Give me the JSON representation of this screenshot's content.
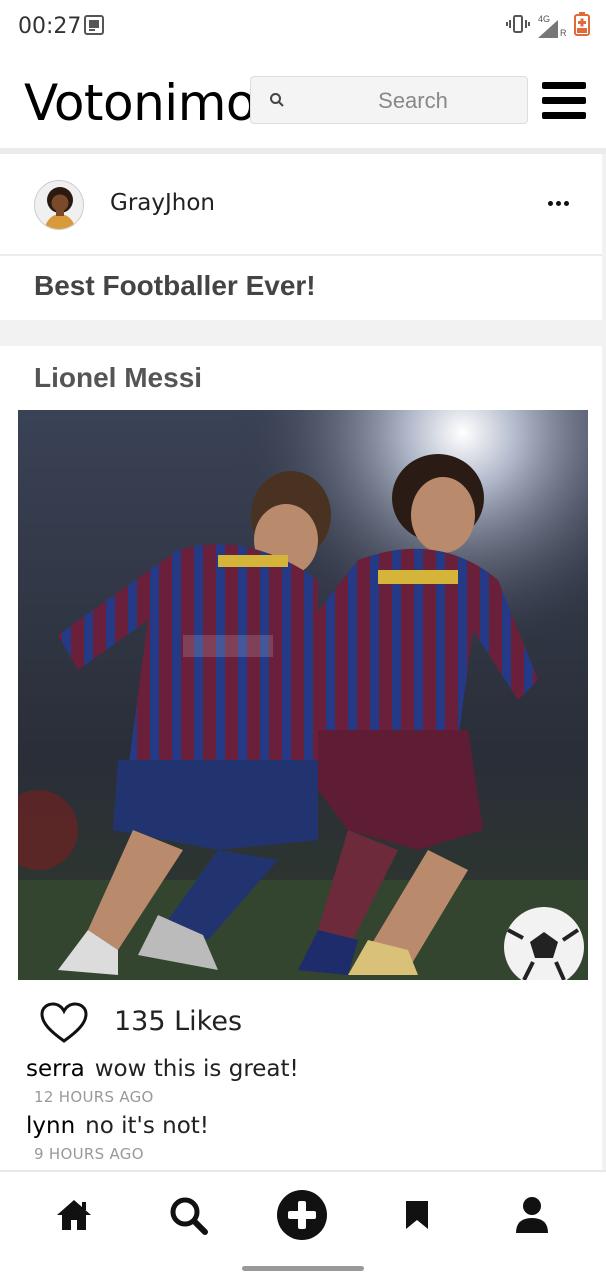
{
  "status_bar": {
    "time": "00:27",
    "network": "4G",
    "roaming": "R",
    "icons": [
      "screenshot-icon",
      "vibrate-icon",
      "signal-icon",
      "battery-icon"
    ]
  },
  "header": {
    "app_title": "Votonimo",
    "search_placeholder": "Search",
    "menu_icon": "hamburger-menu-icon"
  },
  "post": {
    "username": "GrayJhon",
    "caption": "Best Footballer Ever!",
    "more_icon": "more-dots-icon"
  },
  "entry": {
    "title": "Lionel Messi",
    "likes_label": "135 Likes",
    "likes_count": 135,
    "comments": [
      {
        "user": "serra",
        "text": "wow this is great!",
        "time": "12 HOURS AGO"
      },
      {
        "user": "lynn",
        "text": "no it's not!",
        "time": "9 HOURS AGO"
      }
    ]
  },
  "bottom_nav": {
    "items": [
      "home-icon",
      "search-icon",
      "add-icon",
      "bookmark-icon",
      "profile-icon"
    ]
  },
  "colors": {
    "background": "#f2f2f2",
    "card": "#ffffff",
    "text": "#111111",
    "muted": "#999999"
  }
}
